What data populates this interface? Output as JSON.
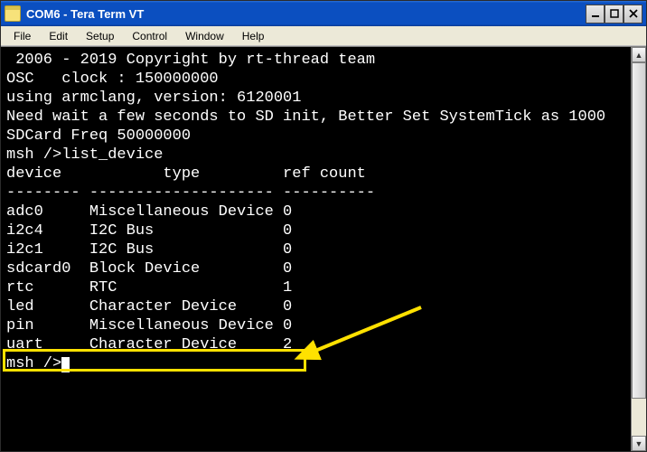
{
  "window": {
    "title": "COM6 - Tera Term VT"
  },
  "menu": {
    "file": "File",
    "edit": "Edit",
    "setup": "Setup",
    "control": "Control",
    "window": "Window",
    "help": "Help"
  },
  "terminal": {
    "lines": [
      " 2006 - 2019 Copyright by rt-thread team",
      "OSC   clock : 150000000",
      "",
      "using armclang, version: 6120001",
      "",
      "",
      "Need wait a few seconds to SD init, Better Set SystemTick as 1000",
      "",
      "SDCard Freq 50000000",
      "",
      "msh />list_device",
      "device           type         ref count",
      "-------- -------------------- ----------",
      "adc0     Miscellaneous Device 0",
      "i2c4     I2C Bus              0",
      "i2c1     I2C Bus              0",
      "sdcard0  Block Device         0",
      "rtc      RTC                  1",
      "led      Character Device     0",
      "pin      Miscellaneous Device 0",
      "uart     Character Device     2"
    ],
    "prompt": "msh />"
  }
}
